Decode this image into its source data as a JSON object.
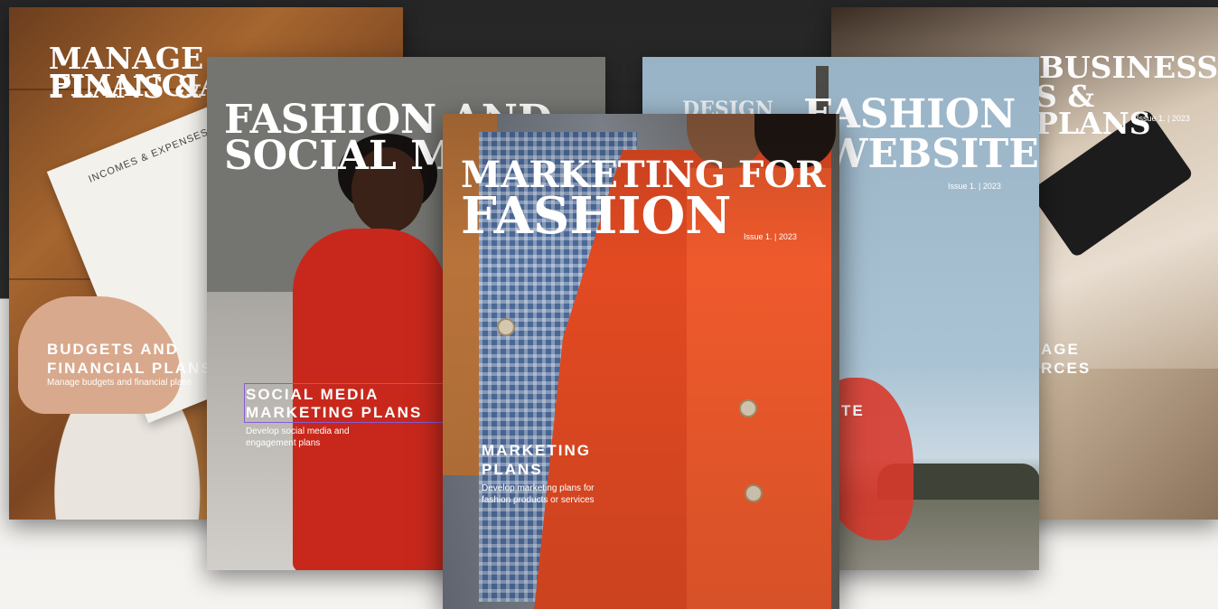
{
  "cards": {
    "finance": {
      "title_line1": "MANAGE FINANCIAL",
      "title_line2": "PLANS & B",
      "paper_heading": "INCOMES & EXPENSES",
      "subtitle_line1": "BUDGETS AND",
      "subtitle_line2": "FINANCIAL PLANS",
      "description": "Manage budgets and financial plans"
    },
    "social": {
      "title_line1": "FASHION AND",
      "title_line2": "SOCIAL M",
      "subtitle_line1": "SOCIAL MEDIA",
      "subtitle_line2": "MARKETING PLANS",
      "description_line1": "Develop social media and",
      "description_line2": "engagement plans"
    },
    "marketing": {
      "title_line1": "MARKETING FOR",
      "title_line2": "FASHION",
      "issue": "Issue 1.  |  2023",
      "subtitle_line1": "MARKETING",
      "subtitle_line2": "PLANS",
      "description_line1": "Develop marketing plans for",
      "description_line2": "fashion products or services"
    },
    "website": {
      "kicker": "DESIGN",
      "title_line1": "FASHION",
      "title_line2": "WEBSITE",
      "issue": "Issue 1.  |  2023",
      "subtitle_fragment": "TE"
    },
    "business": {
      "title_line1": "BUSINESS",
      "title_line2": "S & PLANS",
      "issue": "Issue 1.  |  2023",
      "subtitle_line1": "AGE",
      "subtitle_line2": "RCES"
    }
  },
  "colors": {
    "top_background": "#262626",
    "bottom_background": "#f3f2ef",
    "selection_outline": "#8a5ad8",
    "accent_red": "#e24a22"
  }
}
